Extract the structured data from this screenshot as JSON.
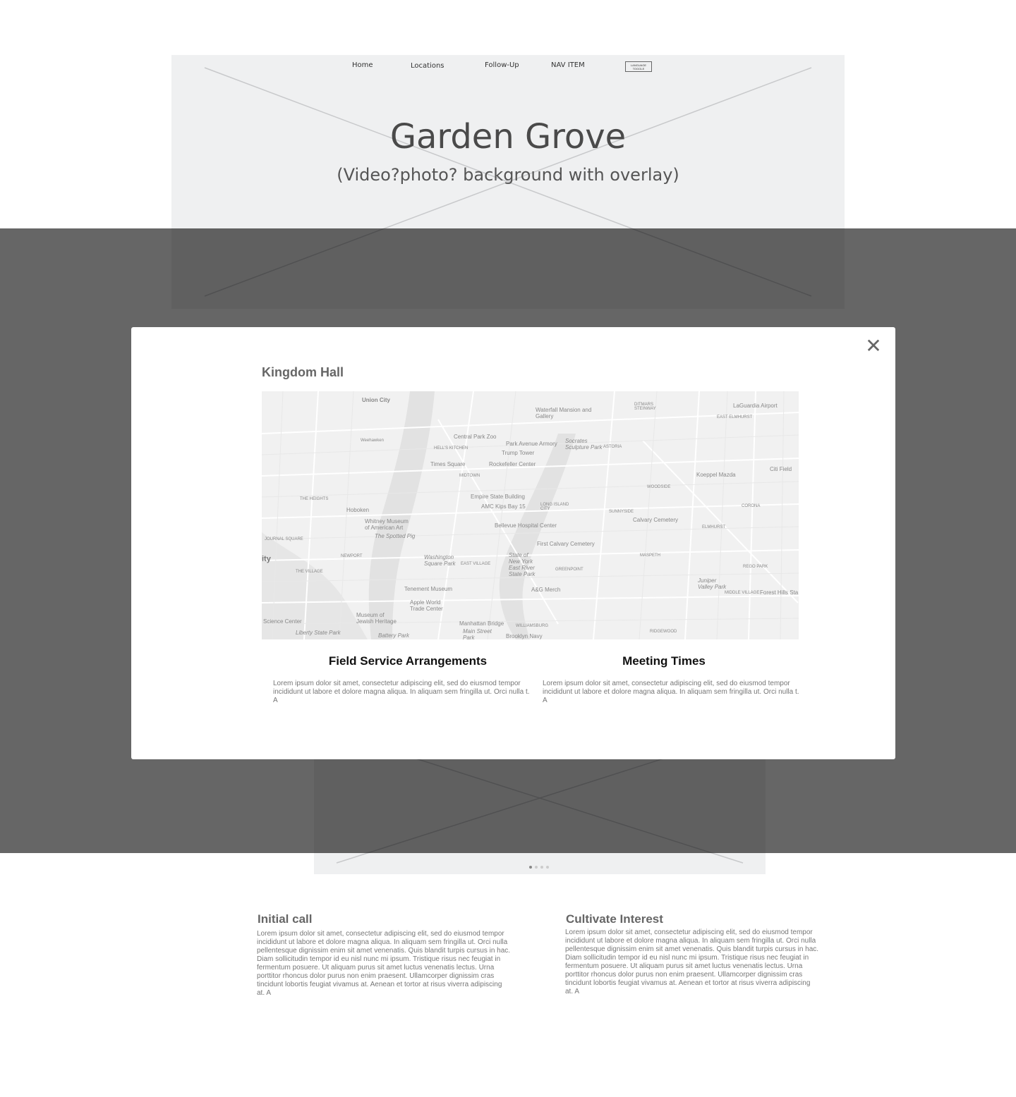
{
  "nav": {
    "items": [
      "Home",
      "Locations",
      "Follow-Up",
      "NAV ITEM"
    ],
    "language_toggle": "LANGUAGE TOGGLE"
  },
  "hero": {
    "title": "Garden Grove",
    "subtitle": "(Video?photo? background with overlay)"
  },
  "modal": {
    "title": "Kingdom Hall",
    "close_icon": "close-icon",
    "map_labels": [
      "Union City",
      "Waterfall Mansion and Gallery",
      "DITMARS STEINWAY",
      "LaGuardia Airport",
      "EAST ELMHURST",
      "Weehawken",
      "Central Park Zoo",
      "Park Avenue Armory",
      "Socrates Sculpture Park",
      "ASTORIA",
      "HELL'S KITCHEN",
      "Trump Tower",
      "Times Square",
      "Rockefeller Center",
      "MIDTOWN",
      "Koeppel Mazda",
      "Citi Field",
      "THE HEIGHTS",
      "Empire State Building",
      "WOODSIDE",
      "Hoboken",
      "AMC Kips Bay 15",
      "LONG ISLAND CITY",
      "SUNNYSIDE",
      "CORONA",
      "Whitney Museum of American Art",
      "Bellevue Hospital Center",
      "Calvary Cemetery",
      "ELMHURST",
      "JOURNAL SQUARE",
      "The Spotted Pig",
      "First Calvary Cemetery",
      "NEWPORT",
      "Washington Square Park",
      "EAST VILLAGE",
      "State of New York East River State Park",
      "GREENPOINT",
      "MASPETH",
      "REGO PARK",
      "THE VILLAGE",
      "Tenement Museum",
      "A&G Merch",
      "Juniper Valley Park",
      "MIDDLE VILLAGE",
      "Forest Hills Sta",
      "Apple World Trade Center",
      "Science Center",
      "Museum of Jewish Heritage",
      "Manhattan Bridge",
      "WILLIAMSBURG",
      "RIDGEWOOD",
      "Battery Park",
      "Main Street Park",
      "Brooklyn Navy",
      "Liberty State Park",
      "ity"
    ],
    "columns": [
      {
        "heading": "Field Service Arrangements",
        "body": "Lorem ipsum dolor sit amet, consectetur adipiscing elit, sed do eiusmod tempor incididunt ut labore et dolore magna aliqua. In aliquam sem fringilla ut. Orci nulla t. A"
      },
      {
        "heading": "Meeting Times",
        "body": "Lorem ipsum dolor sit amet, consectetur adipiscing elit, sed do eiusmod tempor incididunt ut labore et dolore magna aliqua. In aliquam sem fringilla ut. Orci nulla t. A"
      }
    ]
  },
  "slider": {
    "dot_count": 4,
    "active_dot": 1
  },
  "info": [
    {
      "heading": "Initial call",
      "body": "Lorem ipsum dolor sit amet, consectetur adipiscing elit, sed do eiusmod tempor incididunt ut labore et dolore magna aliqua. In aliquam sem fringilla ut. Orci nulla pellentesque dignissim enim sit amet venenatis. Quis blandit turpis cursus in hac. Diam sollicitudin tempor id eu nisl nunc mi ipsum. Tristique risus nec feugiat in fermentum posuere. Ut aliquam purus sit amet luctus venenatis lectus. Urna porttitor rhoncus dolor purus non enim praesent. Ullamcorper dignissim cras tincidunt lobortis feugiat vivamus at. Aenean et tortor at risus viverra adipiscing at. A"
    },
    {
      "heading": "Cultivate Interest",
      "body": "Lorem ipsum dolor sit amet, consectetur adipiscing elit, sed do eiusmod tempor incididunt ut labore et dolore magna aliqua. In aliquam sem fringilla ut. Orci nulla pellentesque dignissim enim sit amet venenatis. Quis blandit turpis cursus in hac. Diam sollicitudin tempor id eu nisl nunc mi ipsum. Tristique risus nec feugiat in fermentum posuere. Ut aliquam purus sit amet luctus venenatis lectus. Urna porttitor rhoncus dolor purus non enim praesent. Ullamcorper dignissim cras tincidunt lobortis feugiat vivamus at. Aenean et tortor at risus viverra adipiscing at. A"
    }
  ]
}
